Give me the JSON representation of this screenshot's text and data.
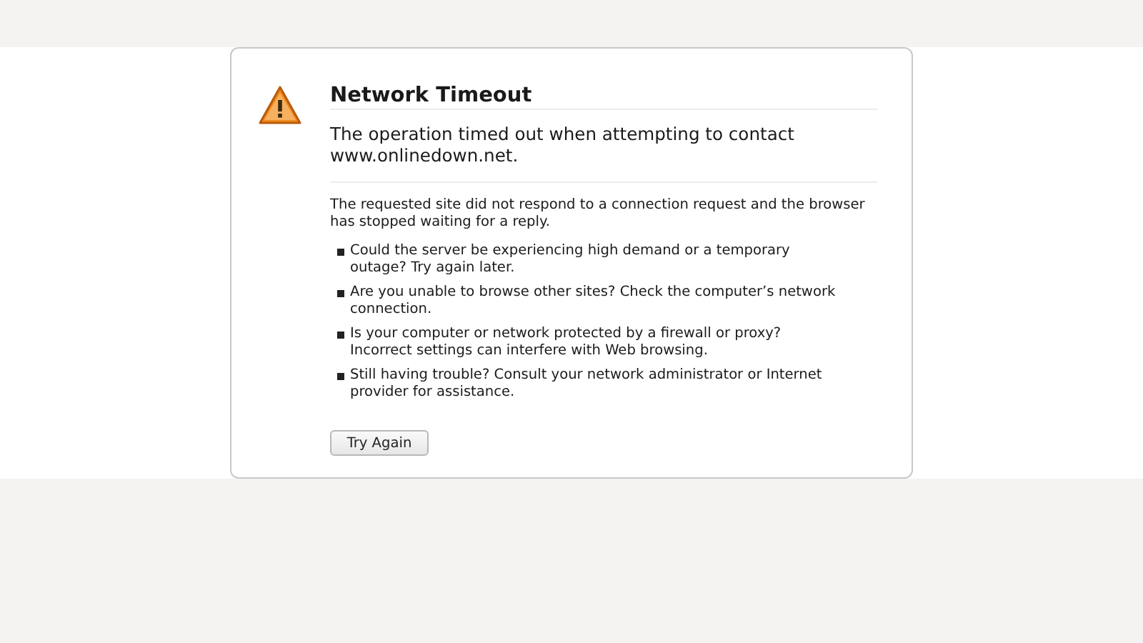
{
  "error": {
    "title": "Network Timeout",
    "short_description": "The operation timed out when attempting to contact www.onlinedown.net.",
    "long_description": "The requested site did not respond to a connection request and the browser has stopped waiting for a reply.",
    "suggestions": [
      "Could the server be experiencing high demand or a temporary outage? Try again later.",
      "Are you unable to browse other sites? Check the computer’s network connection.",
      "Is your computer or network protected by a firewall or proxy? Incorrect settings can interfere with Web browsing.",
      "Still having trouble? Consult your network administrator or Internet provider for assistance."
    ],
    "button": "Try Again"
  }
}
